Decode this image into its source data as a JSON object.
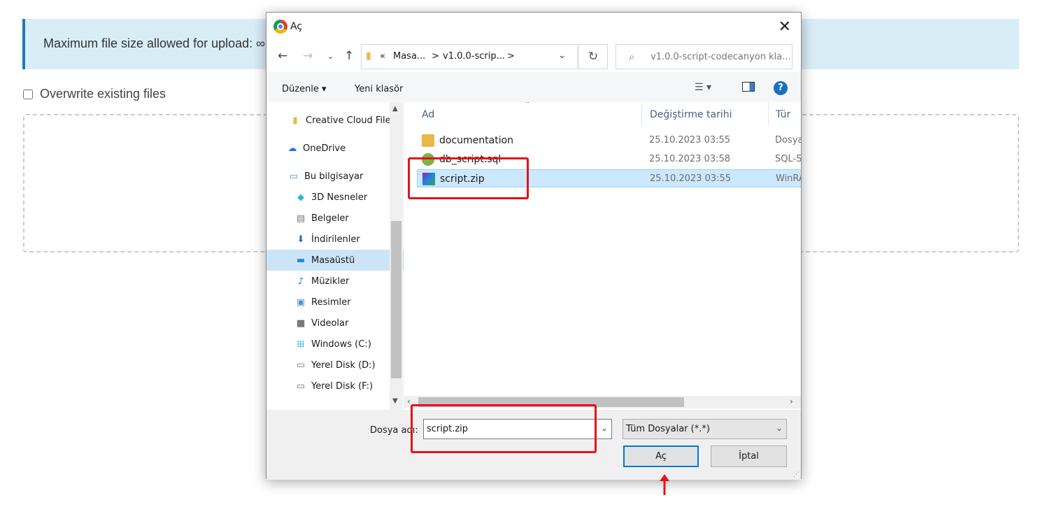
{
  "page": {
    "alert_text": "Maximum file size allowed for upload: ∞",
    "overwrite_label": "Overwrite existing files"
  },
  "dialog": {
    "title": "Aç",
    "address_segments": [
      "«",
      "Masa...",
      ">",
      "v1.0.0-scrip...",
      ">"
    ],
    "search_placeholder": "v1.0.0-script-codecanyon kla...",
    "toolbar": {
      "organize": "Düzenle ▾",
      "new_folder": "Yeni klasör"
    },
    "sidebar": [
      {
        "label": "Creative Cloud Files",
        "icon": "creative-cloud-icon"
      },
      {
        "label": "OneDrive",
        "icon": "onedrive-icon"
      },
      {
        "label": "Bu bilgisayar",
        "icon": "computer-icon"
      },
      {
        "label": "3D Nesneler",
        "icon": "cube-icon"
      },
      {
        "label": "Belgeler",
        "icon": "document-icon"
      },
      {
        "label": "İndirilenler",
        "icon": "download-icon"
      },
      {
        "label": "Masaüstü",
        "icon": "desktop-icon",
        "selected": true
      },
      {
        "label": "Müzikler",
        "icon": "music-icon"
      },
      {
        "label": "Resimler",
        "icon": "picture-icon"
      },
      {
        "label": "Videolar",
        "icon": "video-icon"
      },
      {
        "label": "Windows (C:)",
        "icon": "drive-icon"
      },
      {
        "label": "Yerel Disk (D:)",
        "icon": "drive-icon"
      },
      {
        "label": "Yerel Disk (F:)",
        "icon": "drive-icon"
      }
    ],
    "columns": {
      "name": "Ad",
      "modified": "Değiştirme tarihi",
      "type": "Tür"
    },
    "files": [
      {
        "name": "documentation",
        "date": "25.10.2023 03:55",
        "type": "Dosya",
        "icon": "folder-icon"
      },
      {
        "name": "db_script.sql",
        "date": "25.10.2023 03:58",
        "type": "SQL-S",
        "icon": "sql-icon"
      },
      {
        "name": "script.zip",
        "date": "25.10.2023 03:55",
        "type": "WinRA",
        "icon": "winrar-icon",
        "selected": true
      }
    ],
    "filename_label": "Dosya adı:",
    "filename_value": "script.zip",
    "filter_value": "Tüm Dosyalar (*.*)",
    "open_label": "Aç",
    "cancel_label": "İptal"
  },
  "colors": {
    "highlight": "#e3131b",
    "selection": "#cce8ff",
    "accent": "#0078d7"
  }
}
